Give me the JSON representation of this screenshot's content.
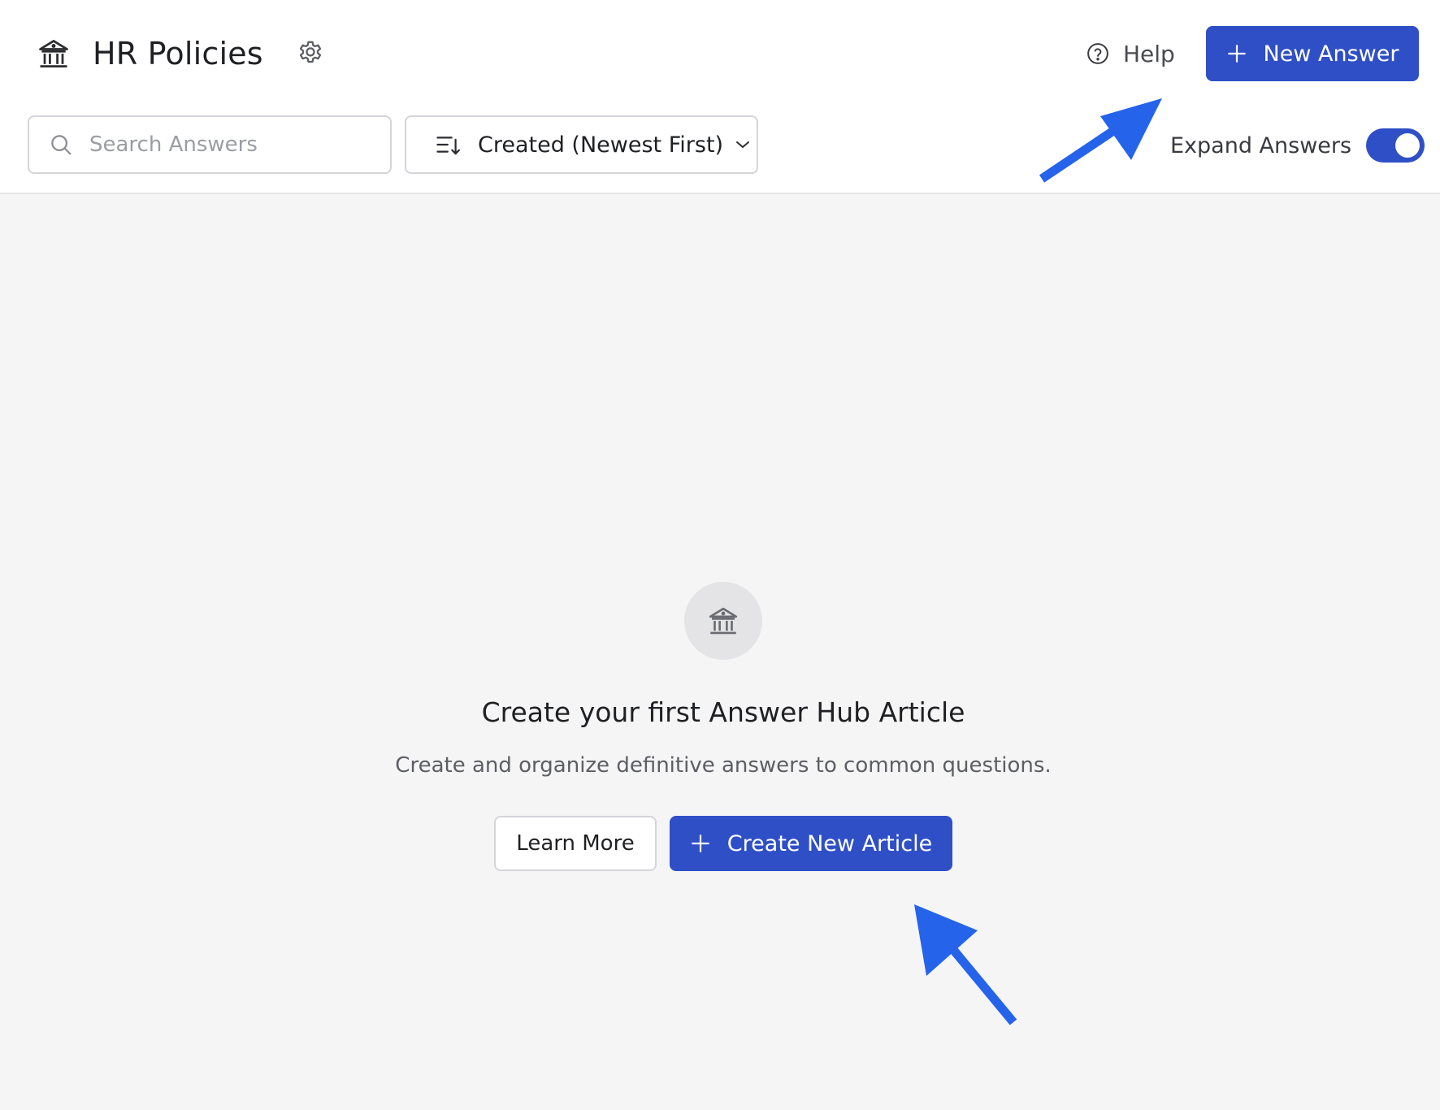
{
  "header": {
    "title": "HR Policies",
    "help_label": "Help",
    "new_answer_label": "New Answer",
    "search": {
      "placeholder": "Search Answers",
      "value": ""
    },
    "sort": {
      "selected": "Created (Newest First)"
    },
    "expand_answers": {
      "label": "Expand Answers",
      "enabled": true
    }
  },
  "empty_state": {
    "title": "Create your first Answer Hub Article",
    "description": "Create and organize definitive answers to common questions.",
    "learn_more_label": "Learn More",
    "create_label": "Create New Article"
  },
  "colors": {
    "primary": "#2f4fc6",
    "annotation_arrow": "#2563eb",
    "background": "#f5f5f6"
  },
  "icons": [
    "bank-icon",
    "gear-icon",
    "help-circle-icon",
    "plus-icon",
    "search-icon",
    "sort-icon",
    "chevron-down-icon"
  ]
}
